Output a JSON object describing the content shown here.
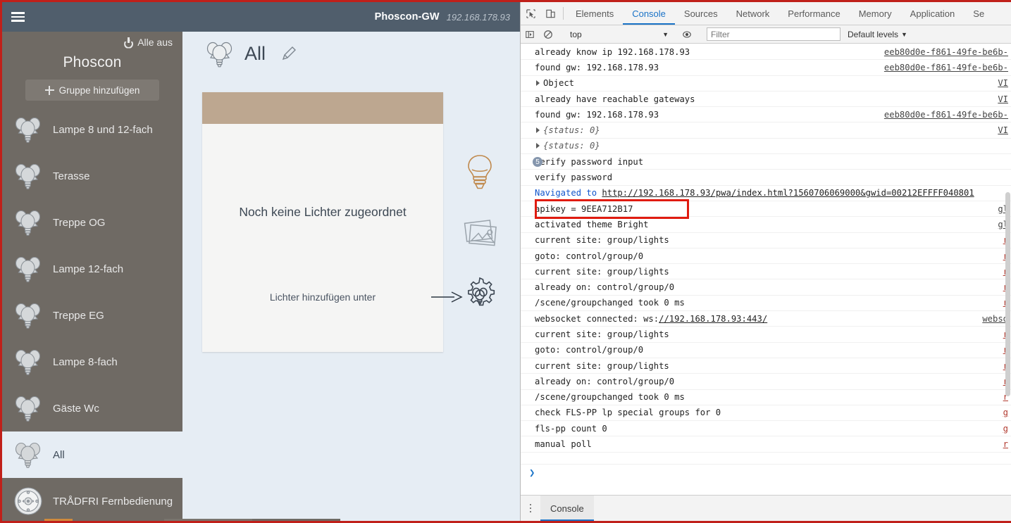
{
  "window": {
    "gateway_name": "Phoscon-GW",
    "gateway_ip": "192.168.178.93"
  },
  "phoscon": {
    "brand": "Phoscon",
    "all_off_label": "Alle aus",
    "add_group_label": "Gruppe hinzufügen",
    "menu_icon": "hamburger-menu-icon",
    "groups": [
      {
        "label": "Lampe 8 und 12-fach",
        "icon": "bulb-group-icon",
        "selected": false
      },
      {
        "label": "Terasse",
        "icon": "bulb-group-icon",
        "selected": false
      },
      {
        "label": "Treppe OG",
        "icon": "bulb-group-icon",
        "selected": false
      },
      {
        "label": "Lampe 12-fach",
        "icon": "bulb-group-icon",
        "selected": false
      },
      {
        "label": "Treppe EG",
        "icon": "bulb-group-icon",
        "selected": false
      },
      {
        "label": "Lampe 8-fach",
        "icon": "bulb-group-icon",
        "selected": false
      },
      {
        "label": "Gäste Wc",
        "icon": "bulb-group-icon",
        "selected": false
      },
      {
        "label": "All",
        "icon": "bulb-group-icon",
        "selected": true
      },
      {
        "label": "TRÅDFRI Fernbedienung",
        "icon": "remote-control-icon",
        "selected": false
      }
    ],
    "main": {
      "title": "All",
      "title_icon": "bulb-group-icon",
      "edit_icon": "pencil-edit-icon",
      "card": {
        "header_color": "#bda790",
        "empty_title": "Noch keine Lichter zugeordnet",
        "hint": "Lichter hinzufügen unter",
        "arrow_icon": "arrow-right-icon"
      },
      "side_icons": [
        {
          "name": "lightbulb-icon",
          "color": "#c08a4e"
        },
        {
          "name": "scenes-photos-icon",
          "color": "#9aa3ab"
        },
        {
          "name": "gear-lights-settings-icon",
          "color": "#4a5462"
        }
      ]
    }
  },
  "devtools": {
    "inspect_icon": "inspect-element-icon",
    "device_icon": "toggle-device-toolbar-icon",
    "tabs": [
      {
        "label": "Elements",
        "active": false
      },
      {
        "label": "Console",
        "active": true
      },
      {
        "label": "Sources",
        "active": false
      },
      {
        "label": "Network",
        "active": false
      },
      {
        "label": "Performance",
        "active": false
      },
      {
        "label": "Memory",
        "active": false
      },
      {
        "label": "Application",
        "active": false
      },
      {
        "label": "Se",
        "active": false
      }
    ],
    "toolbar": {
      "sidebar_toggle_icon": "show-console-sidebar-icon",
      "clear_icon": "clear-console-icon",
      "context": "top",
      "context_caret": "▼",
      "eye_icon": "live-expression-eye-icon",
      "filter_placeholder": "Filter",
      "filter_value": "",
      "levels_label": "Default levels",
      "levels_caret": "▼"
    },
    "prompt_caret": "❯",
    "drawer_tab": "Console",
    "highlight_color": "#e01b10",
    "log": [
      {
        "msg": "already know ip 192.168.178.93",
        "src": "eeb80d0e-f861-49fe-be6b-",
        "kind": "text"
      },
      {
        "msg": "found gw: 192.168.178.93",
        "src": "eeb80d0e-f861-49fe-be6b-",
        "kind": "text"
      },
      {
        "msg": "Object",
        "src": "VI",
        "kind": "object"
      },
      {
        "msg": "already have reachable gateways",
        "src": "VI",
        "kind": "text"
      },
      {
        "msg": "found gw: 192.168.178.93",
        "src": "eeb80d0e-f861-49fe-be6b-",
        "kind": "text"
      },
      {
        "msg": "{status: 0}",
        "src": "VI",
        "kind": "object-italic"
      },
      {
        "msg": "{status: 0}",
        "src": "",
        "kind": "object-italic"
      },
      {
        "msg": "verify password input",
        "src": "",
        "kind": "count",
        "count": "5"
      },
      {
        "msg": "verify password",
        "src": "",
        "kind": "text"
      },
      {
        "msg": "Navigated to http://192.168.178.93/pwa/index.html?1560706069000&gwid=00212EFFFF040801",
        "src": "",
        "kind": "navigated"
      },
      {
        "msg": "apikey = 9EEA712B17",
        "src": "gl",
        "kind": "text",
        "highlight": true
      },
      {
        "msg": "activated theme Bright",
        "src": "gl",
        "kind": "text"
      },
      {
        "msg": "current site: group/lights",
        "src": "r",
        "kind": "text"
      },
      {
        "msg": "goto: control/group/0",
        "src": "r",
        "kind": "text"
      },
      {
        "msg": "current site: group/lights",
        "src": "r",
        "kind": "text"
      },
      {
        "msg": "already on: control/group/0",
        "src": "r",
        "kind": "text"
      },
      {
        "msg": "/scene/groupchanged took 0 ms",
        "src": "r",
        "kind": "text"
      },
      {
        "msg": "websocket connected: ws://192.168.178.93:443/",
        "src": "webso",
        "kind": "websocket"
      },
      {
        "msg": "current site: group/lights",
        "src": "r",
        "kind": "text"
      },
      {
        "msg": "goto: control/group/0",
        "src": "r",
        "kind": "text"
      },
      {
        "msg": "current site: group/lights",
        "src": "r",
        "kind": "text"
      },
      {
        "msg": "already on: control/group/0",
        "src": "r",
        "kind": "text"
      },
      {
        "msg": "/scene/groupchanged took 0 ms",
        "src": "r",
        "kind": "text"
      },
      {
        "msg": "check FLS-PP lp special groups for 0",
        "src": "g",
        "kind": "text"
      },
      {
        "msg": "fls-pp count 0",
        "src": "g",
        "kind": "text"
      },
      {
        "msg": "manual poll",
        "src": "r",
        "kind": "text"
      }
    ]
  }
}
